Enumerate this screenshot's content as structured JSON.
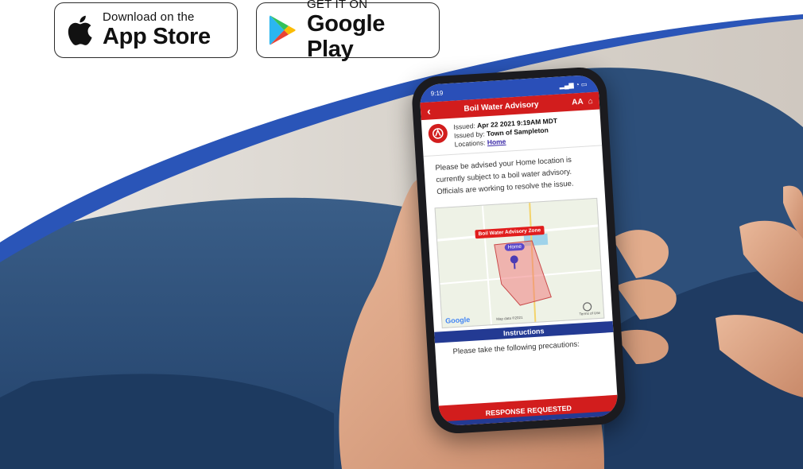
{
  "badges": {
    "apple": {
      "small": "Download on the",
      "big": "App Store"
    },
    "google": {
      "small": "GET IT ON",
      "big": "Google Play"
    }
  },
  "phone": {
    "status_time": "9:19",
    "nav_title": "Boil Water Advisory",
    "nav_font_toggle": "AA",
    "issued_label": "Issued:",
    "issued_value": "Apr 22 2021 9:19AM MDT",
    "issued_by_label": "Issued by:",
    "issued_by_value": "Town of Sampleton",
    "locations_label": "Locations:",
    "locations_value": "Home",
    "message": "Please be advised your Home location is currently subject to a boil water advisory. Officials are working to resolve the issue.",
    "map": {
      "zone_label": "Boil Water Advisory Zone",
      "home_label": "Home",
      "google": "Google",
      "map_data": "Map data ©2021",
      "terms": "Terms of Use"
    },
    "instructions_title": "Instructions",
    "instructions_text": "Please take the following precautions:",
    "response_button": "RESPONSE REQUESTED"
  },
  "colors": {
    "alert_red": "#d21d1d",
    "brand_blue": "#233a93",
    "status_blue": "#2a4fb8"
  }
}
